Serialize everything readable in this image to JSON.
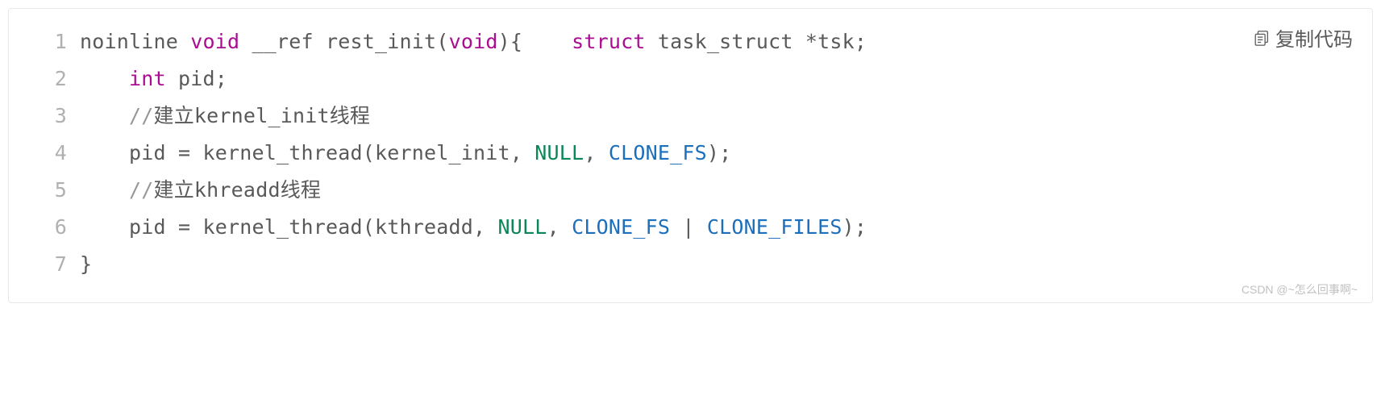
{
  "copy_label": "复制代码",
  "watermark": "CSDN @~怎么回事啊~",
  "lines": [
    {
      "n": "1",
      "segments": [
        {
          "t": "noinline ",
          "c": "ident"
        },
        {
          "t": "void",
          "c": "kw-void"
        },
        {
          "t": " __ref ",
          "c": "ident"
        },
        {
          "t": "rest_init",
          "c": "func"
        },
        {
          "t": "(",
          "c": "paren"
        },
        {
          "t": "void",
          "c": "kw-void"
        },
        {
          "t": ")",
          "c": "paren"
        },
        {
          "t": "{    ",
          "c": "paren"
        },
        {
          "t": "struct",
          "c": "kw-struct"
        },
        {
          "t": " task_struct *tsk;",
          "c": "ident"
        }
      ]
    },
    {
      "n": "2",
      "segments": [
        {
          "t": "    ",
          "c": "ident"
        },
        {
          "t": "int",
          "c": "kw-int"
        },
        {
          "t": " pid;",
          "c": "ident"
        }
      ]
    },
    {
      "n": "3",
      "segments": [
        {
          "t": "    ",
          "c": "ident"
        },
        {
          "t": "//",
          "c": "comment"
        },
        {
          "t": "建立kernel_init线程",
          "c": "cmt-text"
        }
      ]
    },
    {
      "n": "4",
      "segments": [
        {
          "t": "    pid = kernel_thread(kernel_init, ",
          "c": "ident"
        },
        {
          "t": "NULL",
          "c": "null"
        },
        {
          "t": ", ",
          "c": "ident"
        },
        {
          "t": "CLONE_FS",
          "c": "const"
        },
        {
          "t": ");",
          "c": "ident"
        }
      ]
    },
    {
      "n": "5",
      "segments": [
        {
          "t": "    ",
          "c": "ident"
        },
        {
          "t": "//",
          "c": "comment"
        },
        {
          "t": "建立khreadd线程",
          "c": "cmt-text"
        }
      ]
    },
    {
      "n": "6",
      "segments": [
        {
          "t": "    pid = kernel_thread(kthreadd, ",
          "c": "ident"
        },
        {
          "t": "NULL",
          "c": "null"
        },
        {
          "t": ", ",
          "c": "ident"
        },
        {
          "t": "CLONE_FS",
          "c": "const"
        },
        {
          "t": " | ",
          "c": "ident"
        },
        {
          "t": "CLONE_FILES",
          "c": "const"
        },
        {
          "t": ");",
          "c": "ident"
        }
      ]
    },
    {
      "n": "7",
      "segments": [
        {
          "t": "}",
          "c": "paren"
        }
      ]
    }
  ]
}
